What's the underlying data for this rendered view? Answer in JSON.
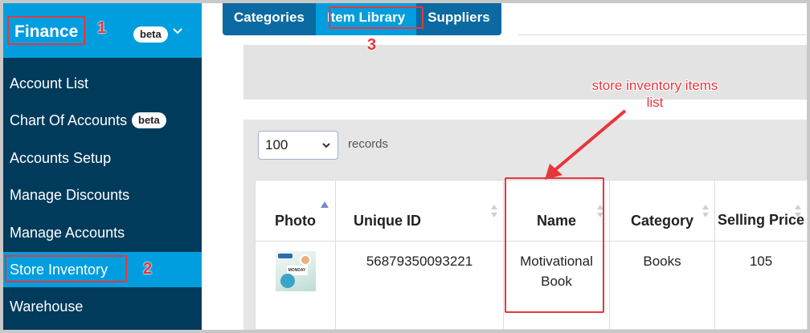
{
  "sidebar": {
    "header": {
      "title": "Finance",
      "badge": "beta"
    },
    "items": [
      {
        "label": "Account List"
      },
      {
        "label": "Chart Of Accounts",
        "badge": "beta"
      },
      {
        "label": "Accounts Setup"
      },
      {
        "label": "Manage Discounts"
      },
      {
        "label": "Manage Accounts"
      },
      {
        "label": "Store Inventory",
        "active": true
      },
      {
        "label": "Warehouse"
      }
    ]
  },
  "tabs": [
    {
      "label": "Categories"
    },
    {
      "label": "Item Library",
      "active": true
    },
    {
      "label": "Suppliers"
    }
  ],
  "table": {
    "page_size": "100",
    "records_label": "records",
    "columns": [
      "Photo",
      "Unique ID",
      "Name",
      "Category",
      "Selling Price"
    ],
    "rows": [
      {
        "photo_text": "MONDAY",
        "unique_id": "56879350093221",
        "name": "Motivational Book",
        "category": "Books",
        "selling_price": "105"
      }
    ]
  },
  "annotations": {
    "step1": "1",
    "step2": "2",
    "step3": "3",
    "note": "store inventory items list"
  },
  "colors": {
    "sidebar_bg": "#003b5c",
    "accent": "#009ede",
    "tabbar": "#0a6aa1",
    "annotation": "#e8363a"
  }
}
